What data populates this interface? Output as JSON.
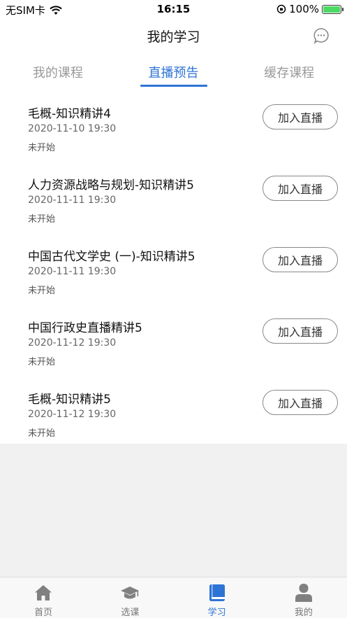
{
  "status_bar": {
    "carrier": "无SIM卡",
    "time": "16:15",
    "battery": "100%"
  },
  "nav": {
    "title": "我的学习"
  },
  "tabs": [
    {
      "label": "我的课程"
    },
    {
      "label": "直播预告"
    },
    {
      "label": "缓存课程"
    }
  ],
  "live_items": [
    {
      "title": "毛概-知识精讲4",
      "time": "2020-11-10 19:30",
      "status": "未开始",
      "button": "加入直播"
    },
    {
      "title": "人力资源战略与规划-知识精讲5",
      "time": "2020-11-11 19:30",
      "status": "未开始",
      "button": "加入直播"
    },
    {
      "title": "中国古代文学史 (一)-知识精讲5",
      "time": "2020-11-11 19:30",
      "status": "未开始",
      "button": "加入直播"
    },
    {
      "title": "中国行政史直播精讲5",
      "time": "2020-11-12 19:30",
      "status": "未开始",
      "button": "加入直播"
    },
    {
      "title": "毛概-知识精讲5",
      "time": "2020-11-12 19:30",
      "status": "未开始",
      "button": "加入直播"
    }
  ],
  "tab_bar": [
    {
      "label": "首页",
      "icon": "home-icon"
    },
    {
      "label": "选课",
      "icon": "graduation-cap-icon"
    },
    {
      "label": "学习",
      "icon": "book-icon"
    },
    {
      "label": "我的",
      "icon": "user-icon"
    }
  ],
  "colors": {
    "accent": "#2d74d5",
    "background_gray": "#f1f1f1",
    "battery_green": "#4cd964"
  }
}
